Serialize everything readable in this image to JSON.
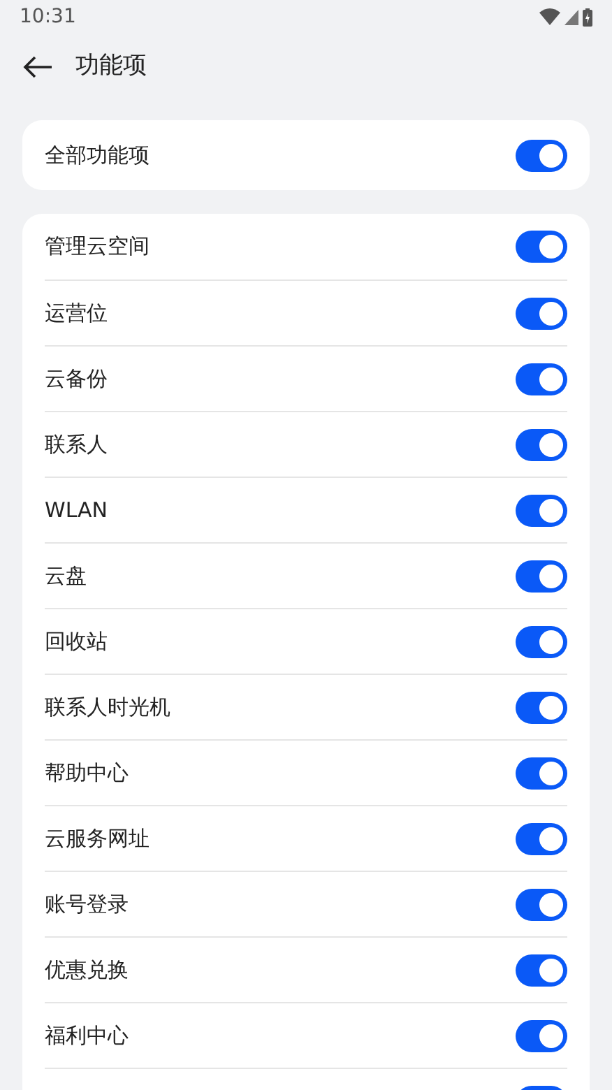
{
  "status_bar": {
    "time": "10:31"
  },
  "header": {
    "title": "功能项"
  },
  "master": {
    "label": "全部功能项",
    "on": true
  },
  "items": [
    {
      "label": "管理云空间",
      "on": true
    },
    {
      "label": "运营位",
      "on": true
    },
    {
      "label": "云备份",
      "on": true
    },
    {
      "label": "联系人",
      "on": true
    },
    {
      "label": "WLAN",
      "on": true
    },
    {
      "label": "云盘",
      "on": true
    },
    {
      "label": "回收站",
      "on": true
    },
    {
      "label": "联系人时光机",
      "on": true
    },
    {
      "label": "帮助中心",
      "on": true
    },
    {
      "label": "云服务网址",
      "on": true
    },
    {
      "label": "账号登录",
      "on": true
    },
    {
      "label": "优惠兑换",
      "on": true
    },
    {
      "label": "福利中心",
      "on": true
    },
    {
      "on": true
    }
  ]
}
